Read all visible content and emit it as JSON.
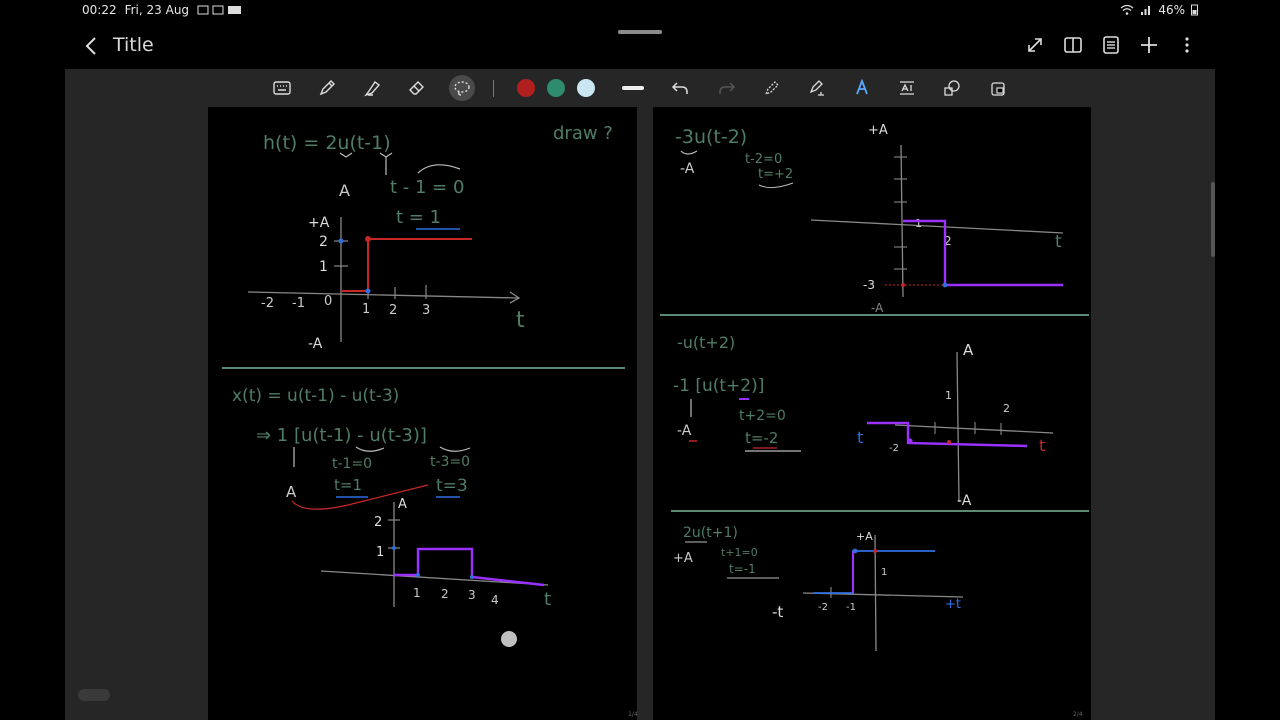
{
  "status": {
    "time": "00:22",
    "date": "Fri, 23 Aug",
    "battery": "46%"
  },
  "header": {
    "title": "Title",
    "icons": [
      "expand-icon",
      "book-view-icon",
      "page-list-icon",
      "add-icon",
      "more-icon"
    ]
  },
  "toolbar": {
    "tools": [
      "keyboard-icon",
      "pen-icon",
      "highlighter-icon",
      "eraser-icon",
      "lasso-icon",
      "line-width-icon",
      "undo-icon",
      "redo-icon",
      "select-pen-icon",
      "text-pen-icon",
      "text-style-icon",
      "text-convert-icon",
      "shapes-icon",
      "read-only-icon"
    ],
    "colors": [
      "#b21f1f",
      "#2e8b6e",
      "#c9e6f2"
    ]
  },
  "page1": {
    "eq1": "h(t) = 2u(t-1)",
    "draw": "draw ?",
    "a_label": "A",
    "shift1": "t - 1 = 0",
    "shift2": "t = 1",
    "y_plus_a": "+A",
    "y2": "2",
    "y1": "1",
    "y_minus_a": "-A",
    "x_ticks": [
      "-2",
      "-1",
      "0",
      "1",
      "2",
      "3"
    ],
    "t_label": "t",
    "eq2": "x(t) = u(t-1) - u(t-3)",
    "eq2b": "⇒ 1 [u(t-1) - u(t-3)]",
    "s1": "t-1=0",
    "s2": "t-3=0",
    "s3": "t=1",
    "s4": "t=3",
    "a2": "A",
    "y_a": "A",
    "yy2": "2",
    "yy1": "1",
    "x2_ticks": [
      "1",
      "2",
      "3",
      "4"
    ],
    "t2": "t",
    "page_num": "1/4"
  },
  "page2": {
    "eq1": "-3u(t-2)",
    "eq1_a": "-A",
    "eq1_s1": "t-2=0",
    "eq1_s2": "t=+2",
    "plus_a": "+A",
    "tick1": "1",
    "tick2": "2",
    "t1": "t",
    "y_minus3": "-3",
    "minus_a": "-A",
    "eq2": "-u(t+2)",
    "eq2b": "-1 [u(t+2)]",
    "eq2_a": "-A",
    "eq2_s1": "t+2=0",
    "eq2_s2": "t=-2",
    "a_top": "A",
    "one": "1",
    "two": "2",
    "neg2": "-2",
    "t_left": "t",
    "t_right": "t",
    "a_bottom": "-A",
    "eq3": "2u(t+1)",
    "eq3_a": "+A",
    "eq3_s1": "t+1=0",
    "eq3_s2": "t=-1",
    "plusA3": "+A",
    "one3": "1",
    "neg_t": "-t",
    "neg2_3": "-2",
    "neg1_3": "-1",
    "plus_t": "+t",
    "page_num": "2/4"
  }
}
